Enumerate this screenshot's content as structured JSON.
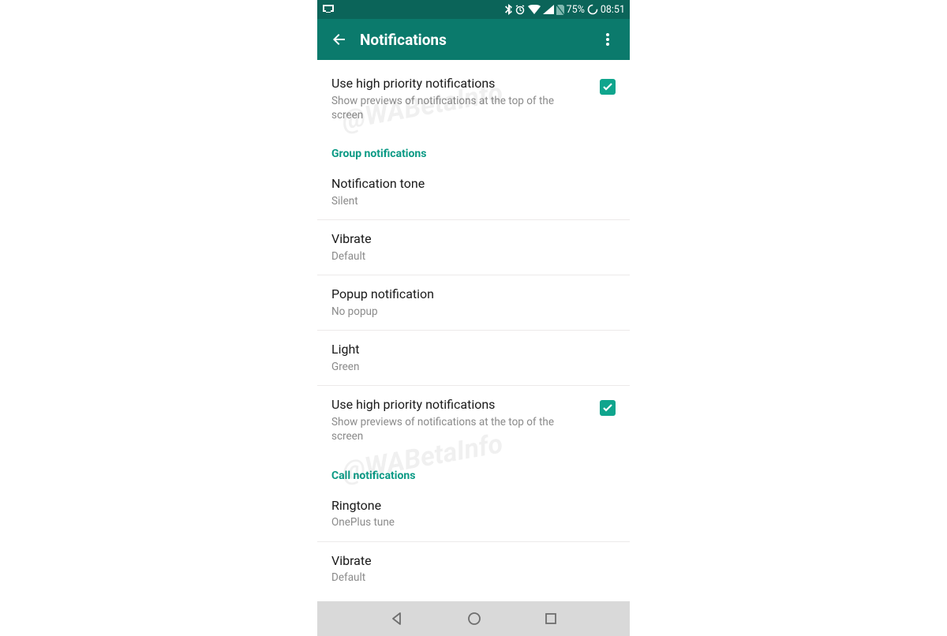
{
  "statusBar": {
    "batteryText": "75%",
    "time": "08:51"
  },
  "appBar": {
    "title": "Notifications"
  },
  "settings": {
    "highPriority1": {
      "title": "Use high priority notifications",
      "sub": "Show previews of notifications at the top of the screen",
      "checked": true
    },
    "sectionGroup": "Group notifications",
    "groupTone": {
      "title": "Notification tone",
      "sub": "Silent"
    },
    "groupVibrate": {
      "title": "Vibrate",
      "sub": "Default"
    },
    "groupPopup": {
      "title": "Popup notification",
      "sub": "No popup"
    },
    "groupLight": {
      "title": "Light",
      "sub": "Green"
    },
    "highPriority2": {
      "title": "Use high priority notifications",
      "sub": "Show previews of notifications at the top of the screen",
      "checked": true
    },
    "sectionCall": "Call notifications",
    "callRingtone": {
      "title": "Ringtone",
      "sub": "OnePlus tune"
    },
    "callVibrate": {
      "title": "Vibrate",
      "sub": "Default"
    }
  },
  "watermark": "@WABetaInfo"
}
